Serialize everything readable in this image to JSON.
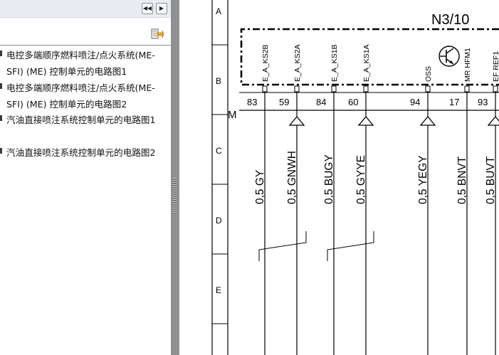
{
  "navigation": {
    "collapse_label": "◀◀",
    "next_label": "▶"
  },
  "bookmarks": {
    "items": [
      {
        "label": "电控多端顺序燃料喷注/点火系统(ME-SFI) (ME) 控制单元的电路图1"
      },
      {
        "label": "电控多端顺序燃料喷注/点火系统(ME-SFI) (ME) 控制单元的电路图2"
      },
      {
        "label": "汽油直接喷注系统控制单元的电路图1"
      },
      {
        "label": "汽油直接喷注系统控制单元的电路图2"
      }
    ]
  },
  "icons": {
    "options": "bookmark-options-icon",
    "transistor": "transistor-icon"
  },
  "schematic": {
    "component": "N3/10",
    "component_color": "#0000e0",
    "connector_label": "M",
    "rows": [
      "A",
      "B",
      "C",
      "D",
      "E"
    ],
    "pins": [
      {
        "name": "E_A_KS2B",
        "number": "83",
        "wire": "0,5 GY"
      },
      {
        "name": "E_A_KS2A",
        "number": "59",
        "wire": "0,5 GNWH"
      },
      {
        "name": "E_A_KS1B",
        "number": "84",
        "wire": "0,5 BUGY"
      },
      {
        "name": "E_A_KS1A",
        "number": "60",
        "wire": "0,5 GYYE"
      },
      {
        "name": "OSS",
        "number": "94",
        "wire": "0,5 YEGY"
      },
      {
        "name": "MR HFM1",
        "number": "17",
        "wire": "0,5 BNVT"
      },
      {
        "name": "EF REF1",
        "number": "93",
        "wire": "0,5 BUVT"
      }
    ]
  }
}
